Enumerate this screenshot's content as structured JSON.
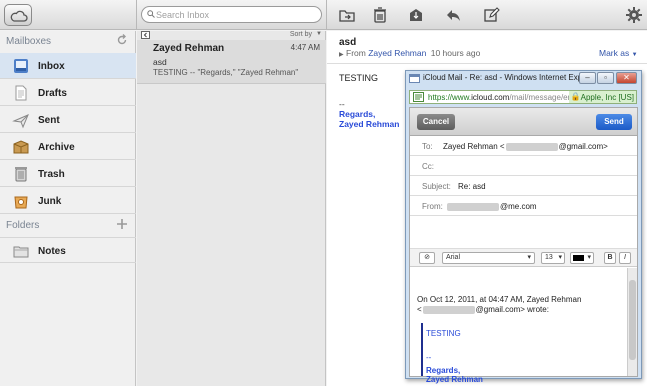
{
  "toolbar": {
    "search_placeholder": "Search Inbox"
  },
  "sidebar": {
    "mailboxes_header": "Mailboxes",
    "mailboxes": [
      {
        "label": "Inbox",
        "icon": "inbox-icon",
        "selected": true
      },
      {
        "label": "Drafts",
        "icon": "drafts-icon"
      },
      {
        "label": "Sent",
        "icon": "sent-icon"
      },
      {
        "label": "Archive",
        "icon": "archive-icon"
      },
      {
        "label": "Trash",
        "icon": "trash-icon"
      },
      {
        "label": "Junk",
        "icon": "junk-icon"
      }
    ],
    "folders_header": "Folders",
    "folders": [
      {
        "label": "Notes",
        "icon": "folder-icon"
      }
    ]
  },
  "list": {
    "sort_label": "Sort by",
    "messages": [
      {
        "sender": "Zayed Rehman",
        "time": "4:47 AM",
        "subject": "asd",
        "preview": "TESTING -- \"Regards,\" \"Zayed Rehman\""
      }
    ]
  },
  "reader": {
    "subject": "asd",
    "from_prefix": "From",
    "from_name": "Zayed Rehman",
    "when": "10 hours ago",
    "mark_as": "Mark as",
    "body_text": "TESTING",
    "sig_dashes": "--",
    "sig_regards": "Regards,",
    "sig_name": "Zayed Rehman"
  },
  "popup": {
    "title": "iCloud Mail - Re: asd - Windows Internet Expl...",
    "url_scheme": "https://www.",
    "url_domain": "icloud.com",
    "url_path": "/mail/message/en-u",
    "cert": "Apple, Inc [US]",
    "cancel": "Cancel",
    "send": "Send",
    "to_label": "To:",
    "to_name": "Zayed Rehman <",
    "to_domain": "@gmail.com>",
    "cc_label": "Cc:",
    "subject_label": "Subject:",
    "subject_value": "Re: asd",
    "from_label": "From:",
    "from_domain": "@me.com",
    "font": "Arial",
    "size": "13",
    "bold": "B",
    "italic": "I",
    "quote_header_1": "On Oct 12, 2011, at 04:47 AM, Zayed Rehman",
    "quote_header_2_prefix": "<",
    "quote_header_2_suffix": "@gmail.com> wrote:",
    "quote_body": "TESTING",
    "quote_dashes": "--",
    "quote_regards": "Regards,",
    "quote_name": "Zayed Rehman"
  },
  "colors": {
    "accent": "#2a4bd8",
    "link": "#3355aa",
    "selected": "#d8e4f2"
  }
}
